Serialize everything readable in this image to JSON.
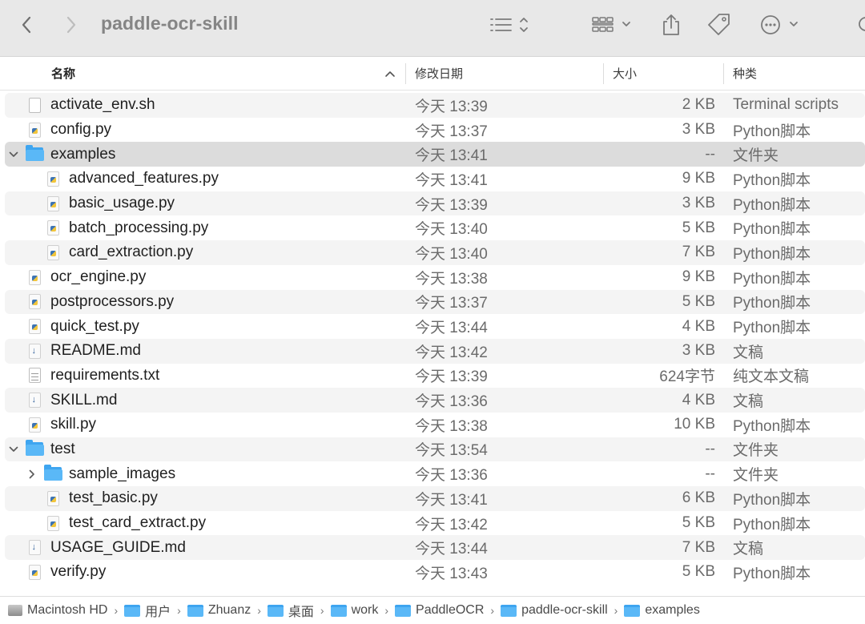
{
  "toolbar": {
    "title": "paddle-ocr-skill",
    "back_icon": "chevron-left-icon",
    "forward_icon": "chevron-right-icon"
  },
  "header": {
    "name": "名称",
    "date": "修改日期",
    "size": "大小",
    "kind": "种类"
  },
  "files": [
    {
      "name": "activate_env.sh",
      "date": "今天 13:39",
      "size": "2 KB",
      "kind": "Terminal scripts",
      "icon": "doc",
      "indent": 0,
      "chevron": ""
    },
    {
      "name": "config.py",
      "date": "今天 13:37",
      "size": "3 KB",
      "kind": "Python脚本",
      "icon": "py",
      "indent": 0,
      "chevron": ""
    },
    {
      "name": "examples",
      "date": "今天 13:41",
      "size": "--",
      "kind": "文件夹",
      "icon": "folder",
      "indent": 0,
      "chevron": "open"
    },
    {
      "name": "advanced_features.py",
      "date": "今天 13:41",
      "size": "9 KB",
      "kind": "Python脚本",
      "icon": "py",
      "indent": 1,
      "chevron": ""
    },
    {
      "name": "basic_usage.py",
      "date": "今天 13:39",
      "size": "3 KB",
      "kind": "Python脚本",
      "icon": "py",
      "indent": 1,
      "chevron": ""
    },
    {
      "name": "batch_processing.py",
      "date": "今天 13:40",
      "size": "5 KB",
      "kind": "Python脚本",
      "icon": "py",
      "indent": 1,
      "chevron": ""
    },
    {
      "name": "card_extraction.py",
      "date": "今天 13:40",
      "size": "7 KB",
      "kind": "Python脚本",
      "icon": "py",
      "indent": 1,
      "chevron": ""
    },
    {
      "name": "ocr_engine.py",
      "date": "今天 13:38",
      "size": "9 KB",
      "kind": "Python脚本",
      "icon": "py",
      "indent": 0,
      "chevron": ""
    },
    {
      "name": "postprocessors.py",
      "date": "今天 13:37",
      "size": "5 KB",
      "kind": "Python脚本",
      "icon": "py",
      "indent": 0,
      "chevron": ""
    },
    {
      "name": "quick_test.py",
      "date": "今天 13:44",
      "size": "4 KB",
      "kind": "Python脚本",
      "icon": "py",
      "indent": 0,
      "chevron": ""
    },
    {
      "name": "README.md",
      "date": "今天 13:42",
      "size": "3 KB",
      "kind": "文稿",
      "icon": "md",
      "indent": 0,
      "chevron": ""
    },
    {
      "name": "requirements.txt",
      "date": "今天 13:39",
      "size": "624字节",
      "kind": "纯文本文稿",
      "icon": "txt",
      "indent": 0,
      "chevron": ""
    },
    {
      "name": "SKILL.md",
      "date": "今天 13:36",
      "size": "4 KB",
      "kind": "文稿",
      "icon": "md",
      "indent": 0,
      "chevron": ""
    },
    {
      "name": "skill.py",
      "date": "今天 13:38",
      "size": "10 KB",
      "kind": "Python脚本",
      "icon": "py",
      "indent": 0,
      "chevron": ""
    },
    {
      "name": "test",
      "date": "今天 13:54",
      "size": "--",
      "kind": "文件夹",
      "icon": "folder",
      "indent": 0,
      "chevron": "open"
    },
    {
      "name": "sample_images",
      "date": "今天 13:36",
      "size": "--",
      "kind": "文件夹",
      "icon": "folder",
      "indent": 1,
      "chevron": "closed"
    },
    {
      "name": "test_basic.py",
      "date": "今天 13:41",
      "size": "6 KB",
      "kind": "Python脚本",
      "icon": "py",
      "indent": 1,
      "chevron": ""
    },
    {
      "name": "test_card_extract.py",
      "date": "今天 13:42",
      "size": "5 KB",
      "kind": "Python脚本",
      "icon": "py",
      "indent": 1,
      "chevron": ""
    },
    {
      "name": "USAGE_GUIDE.md",
      "date": "今天 13:44",
      "size": "7 KB",
      "kind": "文稿",
      "icon": "md",
      "indent": 0,
      "chevron": ""
    },
    {
      "name": "verify.py",
      "date": "今天 13:43",
      "size": "5 KB",
      "kind": "Python脚本",
      "icon": "py",
      "indent": 0,
      "chevron": ""
    }
  ],
  "selected_row": 2,
  "path": [
    {
      "label": "Macintosh HD",
      "icon": "hd"
    },
    {
      "label": "用户",
      "icon": "folder"
    },
    {
      "label": "Zhuanz",
      "icon": "folder"
    },
    {
      "label": "桌面",
      "icon": "folder"
    },
    {
      "label": "work",
      "icon": "folder"
    },
    {
      "label": "PaddleOCR",
      "icon": "folder"
    },
    {
      "label": "paddle-ocr-skill",
      "icon": "folder"
    },
    {
      "label": "examples",
      "icon": "folder"
    }
  ],
  "colors": {
    "folder": "#5ab8f7",
    "toolbar_bg": "#e8e8e8",
    "row_alt": "#f4f4f4",
    "row_selected": "#dcdcdc"
  }
}
